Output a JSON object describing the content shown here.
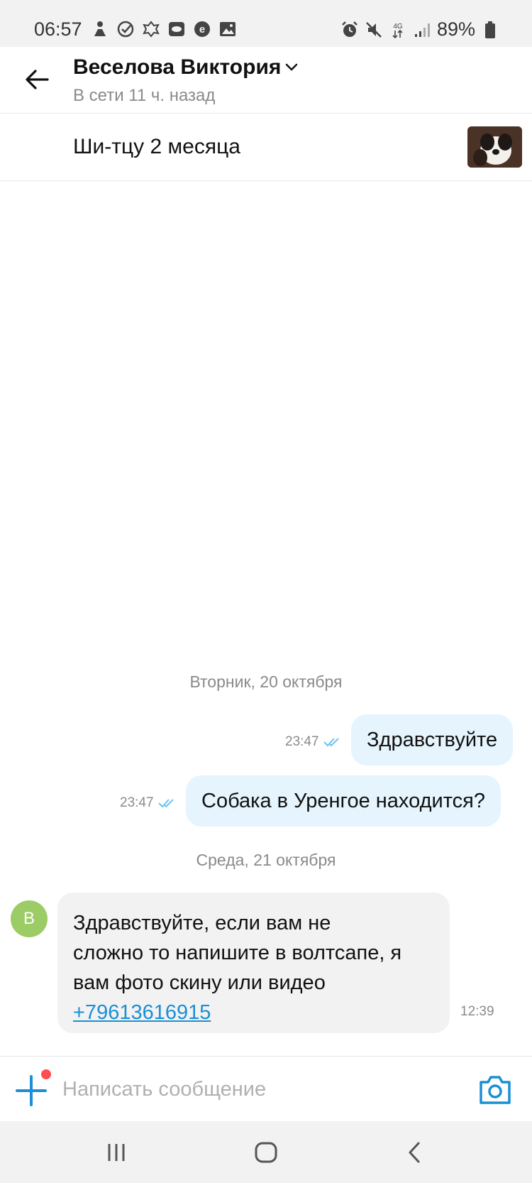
{
  "status_bar": {
    "time": "06:57",
    "battery": "89%",
    "network": "4G",
    "left_icons": [
      "accessibility-icon",
      "check-circle-icon",
      "emblem-icon",
      "screen-icon",
      "e-icon",
      "image-icon"
    ],
    "right_icons": [
      "alarm-icon",
      "mute-icon",
      "signal-icon",
      "battery-icon"
    ]
  },
  "header": {
    "contact_name": "Веселова Виктория",
    "contact_status": "В сети 11 ч. назад"
  },
  "listing": {
    "title": "Ши-тцу 2 месяца"
  },
  "chat": {
    "date1": "Вторник, 20 октября",
    "msg1": {
      "text": "Здравствуйте",
      "time": "23:47"
    },
    "msg2": {
      "text": "Собака в Уренгое находится?",
      "time": "23:47"
    },
    "date2": "Среда, 21 октября",
    "msg3": {
      "avatar_letter": "В",
      "line1": "Здравствуйте,  если вам не",
      "line2": "сложно то напишите в волтсапе, я",
      "line3": "вам фото  скину или видео",
      "phone": "+79613616915",
      "time": "12:39"
    }
  },
  "composer": {
    "placeholder": "Написать сообщение"
  },
  "colors": {
    "accent": "#1a8fd6",
    "outgoing_bubble": "#e5f4fd",
    "incoming_bubble": "#f2f2f2",
    "avatar": "#9ccc65"
  }
}
